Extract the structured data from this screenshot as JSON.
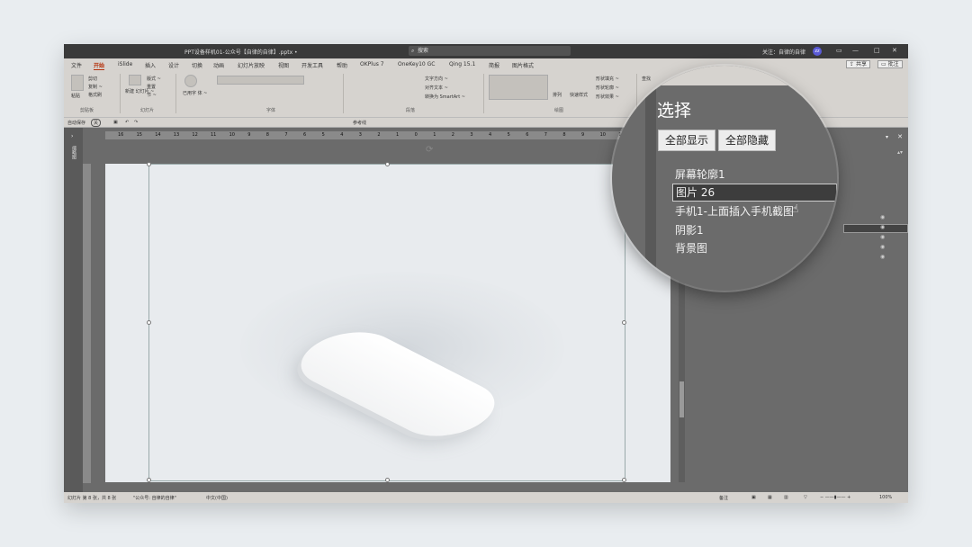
{
  "titlebar": {
    "doc_title": "PPT设备样机01-公众号【自律的自律】.pptx  •",
    "search": "搜索",
    "follow": "关注：自律的自律",
    "avatar": "zz",
    "minimize": "—",
    "restore": "□",
    "close": "✕"
  },
  "menu": {
    "tabs": [
      "文件",
      "开始",
      "iSlide",
      "插入",
      "设计",
      "切换",
      "动画",
      "幻灯片放映",
      "视图",
      "开发工具",
      "帮助",
      "OKPlus 7",
      "OneKey10 GC",
      "Qing 15.1",
      "简报",
      "图片格式"
    ],
    "active_index": 1,
    "share": "共享",
    "comment": "批注"
  },
  "ribbon": {
    "clipboard": {
      "group": "剪贴板",
      "paste": "粘贴",
      "cut": "剪切",
      "copy": "复制 ~",
      "painter": "格式刷"
    },
    "slides": {
      "group": "幻灯片",
      "new": "新建\n幻灯片 ~",
      "layout": "版式 ~",
      "reset": "重置",
      "section": "节 ~"
    },
    "font": {
      "group": "字体",
      "reuse": "已用字\n体 ~"
    },
    "paragraph": {
      "group": "段落",
      "text_dir": "文字方向 ~",
      "align": "对齐文本 ~",
      "smartart": "转换为 SmartArt ~"
    },
    "drawing": {
      "group": "绘图",
      "arrange": "排列",
      "quick": "快速样式",
      "fill": "形状填充 ~",
      "outline": "形状轮廓 ~",
      "effect": "形状效果 ~"
    },
    "editing": {
      "find": "查找"
    }
  },
  "qat": {
    "autosave": "自动保存",
    "toggle": "关",
    "ref": "参考线"
  },
  "left_strip": {
    "label": "缩略图"
  },
  "ruler": {
    "marks": [
      "16",
      "15",
      "14",
      "13",
      "12",
      "11",
      "10",
      "9",
      "8",
      "7",
      "6",
      "5",
      "4",
      "3",
      "2",
      "1",
      "0",
      "1",
      "2",
      "3",
      "4",
      "5",
      "6",
      "7",
      "8",
      "9",
      "10",
      "11",
      "12",
      "13"
    ]
  },
  "selection_pane": {
    "title": "选择",
    "show_all": "全部显示",
    "hide_all": "全部隐藏",
    "items": [
      "屏幕轮廓1",
      "图片 26",
      "手机1-上面插入手机截图",
      "阴影1",
      "背景图"
    ],
    "selected_index": 1
  },
  "statusbar": {
    "slide": "幻灯片 第 8 张，共 8 张",
    "pub": "\"公众号: 自律的自律\"",
    "lang": "中文(中国)",
    "notes": "备注",
    "zoom": "100%"
  }
}
